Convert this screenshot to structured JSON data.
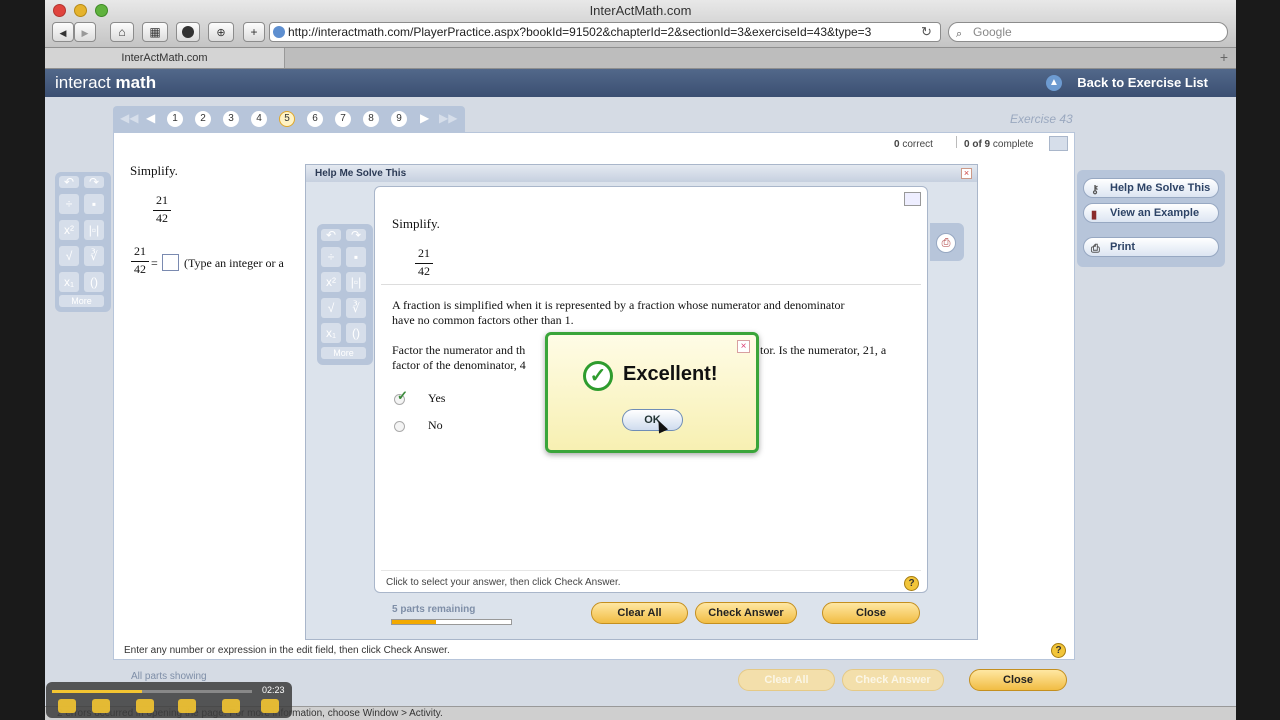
{
  "browser": {
    "window_title": "InterActMath.com",
    "url": "http://interactmath.com/PlayerPractice.aspx?bookId=91502&chapterId=2&sectionId=3&exerciseId=43&type=3",
    "search_placeholder": "Google",
    "tab_title": "InterActMath.com",
    "new_tab_label": "+",
    "back_label": "◀",
    "forward_label": "▶",
    "home_label": "⌂",
    "grid_label": "▦",
    "reload_label": "↻"
  },
  "app": {
    "logo_light": "interact",
    "logo_bold": "math",
    "back_link": "Back to Exercise List"
  },
  "exercise": {
    "label": "Exercise 43",
    "pages": [
      "1",
      "2",
      "3",
      "4",
      "5",
      "6",
      "7",
      "8",
      "9"
    ],
    "current_page": "5",
    "correct_count": "0",
    "correct_label": "correct",
    "complete_count": "0 of 9",
    "complete_label": "complete",
    "instruction": "Simplify.",
    "numerator": "21",
    "denominator": "42",
    "equals": "=",
    "answer_hint": "(Type an integer or a",
    "bottom_hint": "Enter any number or expression in the edit field, then click Check Answer.",
    "parts_showing": "All parts showing",
    "more_label": "More"
  },
  "right_tools": {
    "help_me_solve": "Help Me Solve This",
    "view_example": "View an Example",
    "print": "Print"
  },
  "bottom_buttons": {
    "clear_all": "Clear All",
    "check_answer": "Check Answer",
    "close": "Close"
  },
  "help_dialog": {
    "title": "Help Me Solve This",
    "instruction": "Simplify.",
    "numerator": "21",
    "denominator": "42",
    "para1": "A fraction is simplified when it is represented by a fraction whose numerator and denominator have no common factors other than 1.",
    "para2_left_1": "Factor the numerator and th",
    "para2_right_1": "tor. Is the numerator, 21, a",
    "para2_left_2": "factor of the denominator, 4",
    "options": [
      "Yes",
      "No"
    ],
    "selected_option": "Yes",
    "hint": "Click to select your answer, then click Check Answer.",
    "parts_remaining": "5 parts remaining",
    "parts_progress": 0.37,
    "clear_all": "Clear All",
    "check_answer": "Check Answer",
    "close": "Close",
    "more_label": "More"
  },
  "modal": {
    "message": "Excellent!",
    "ok": "OK",
    "check_glyph": "✓",
    "close_glyph": "×"
  },
  "status": {
    "text": "2 errors occurred in opening the page. For more information, choose Window > Activity."
  },
  "player": {
    "time": "02:23",
    "progress": 0.45
  },
  "help_glyph": "?",
  "colors": {
    "accent_gold": "#f1bd44",
    "header_blue": "#3b4f72",
    "success_green": "#3aa53a"
  }
}
